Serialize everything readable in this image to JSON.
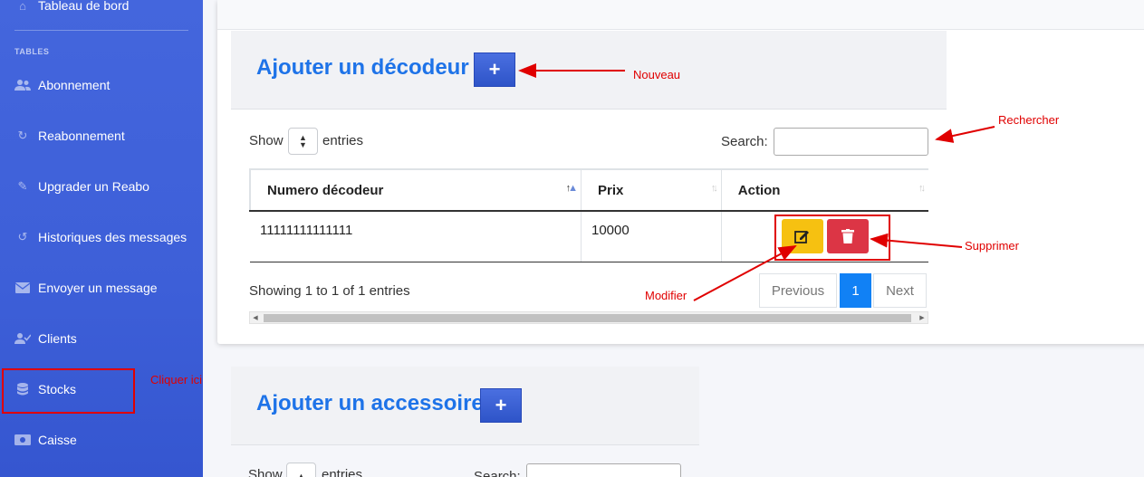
{
  "sidebar": {
    "top_item": {
      "label": "Tableau de bord",
      "icon": "home-icon"
    },
    "section_heading": "TABLES",
    "items": [
      {
        "label": "Abonnement",
        "icon": "users-icon"
      },
      {
        "label": "Reabonnement",
        "icon": "redo-icon"
      },
      {
        "label": "Upgrader un Reabo",
        "icon": "edit-icon"
      },
      {
        "label": "Historiques des messages",
        "icon": "history-icon"
      },
      {
        "label": "Envoyer un message",
        "icon": "envelope-icon"
      },
      {
        "label": "Clients",
        "icon": "user-check-icon"
      },
      {
        "label": "Stocks",
        "icon": "database-icon"
      },
      {
        "label": "Caisse",
        "icon": "money-icon"
      }
    ],
    "background": "#4466dd"
  },
  "decodeur": {
    "title": "Ajouter un décodeur",
    "add_label": "+",
    "show_label": "Show",
    "entries_label": "entries",
    "search_label": "Search:",
    "columns": [
      "Numero décodeur",
      "Prix",
      "Action"
    ],
    "rows": [
      {
        "numero": "11111111111111",
        "prix": "10000"
      }
    ],
    "info": "Showing 1 to 1 of 1 entries",
    "pagination": {
      "previous": "Previous",
      "page": "1",
      "next": "Next"
    }
  },
  "accessoire": {
    "title": "Ajouter un accessoire",
    "add_label": "+",
    "show_label": "Show",
    "entries_label": "entries",
    "search_label": "Search:"
  },
  "annotations": {
    "nouveau": "Nouveau",
    "rechercher": "Rechercher",
    "supprimer": "Supprimer",
    "modifier": "Modifier",
    "cliquer_ici": "Cliquer ici"
  },
  "colors": {
    "accent": "#1e73e8",
    "annotation": "#e00000",
    "edit_button": "#f6c111",
    "delete_button": "#dc3545",
    "active_page": "#1181f5"
  }
}
